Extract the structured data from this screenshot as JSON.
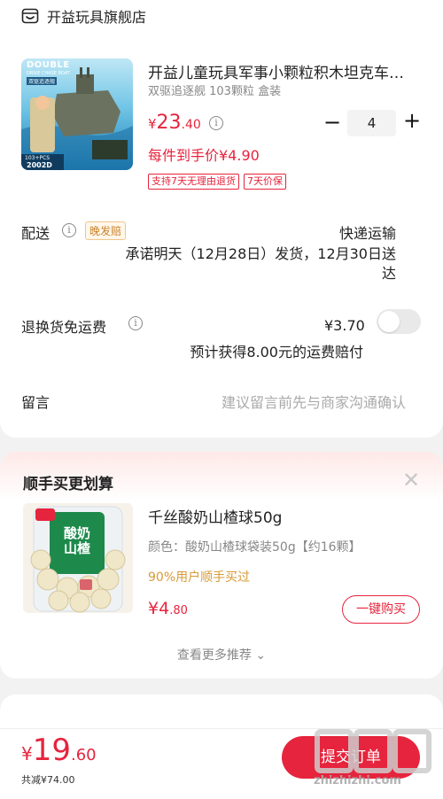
{
  "store": {
    "name": "开益玩具旗舰店",
    "icon": "store-icon"
  },
  "product": {
    "title": "开益儿童玩具军事小颗粒积木坦克车…",
    "spec": "双驱追逐舰 103颗粒 盒装",
    "price_yen": "¥",
    "price_int": "23",
    "price_dec": ".40",
    "quantity": "4",
    "per_item_price": "每件到手价¥4.90",
    "tags": [
      "支持7天无理由退货",
      "7天价保"
    ],
    "image_text": {
      "top": "DOUBLE",
      "sub": "DRIVE CHASE BOAT",
      "chip": "双驱追逐舰",
      "count": "103+PCS",
      "model": "2002D"
    }
  },
  "delivery": {
    "label": "配送",
    "badge": "晚发赔",
    "method": "快递运输",
    "promise": "承诺明天（12月28日）发货，12月30日送达"
  },
  "returns": {
    "label": "退换货免运费",
    "price": "¥3.70",
    "desc": "预计获得8.00元的运费赔付"
  },
  "message": {
    "label": "留言",
    "placeholder": "建议留言前先与商家沟通确认"
  },
  "recommend": {
    "title": "顺手买更划算",
    "item": {
      "name": "千丝酸奶山楂球50g",
      "spec": "颜色：酸奶山楂球袋装50g【约16颗】",
      "social": "90%用户顺手买过",
      "price_yen": "¥",
      "price_int": "4",
      "price_dec": ".80",
      "buy_label": "一键购买",
      "image_text": "酸奶山楂"
    },
    "more_label": "查看更多推荐 ⌄"
  },
  "footer": {
    "total_yen": "¥",
    "total_int": "19",
    "total_dec": ".60",
    "saved": "共减¥74.00",
    "submit_label": "提交订单"
  },
  "watermark": {
    "text": "zhizhizhi.com",
    "logo": "值值值"
  },
  "colors": {
    "accent": "#e6243d",
    "badge": "#c9832e",
    "social": "#d79a37"
  }
}
